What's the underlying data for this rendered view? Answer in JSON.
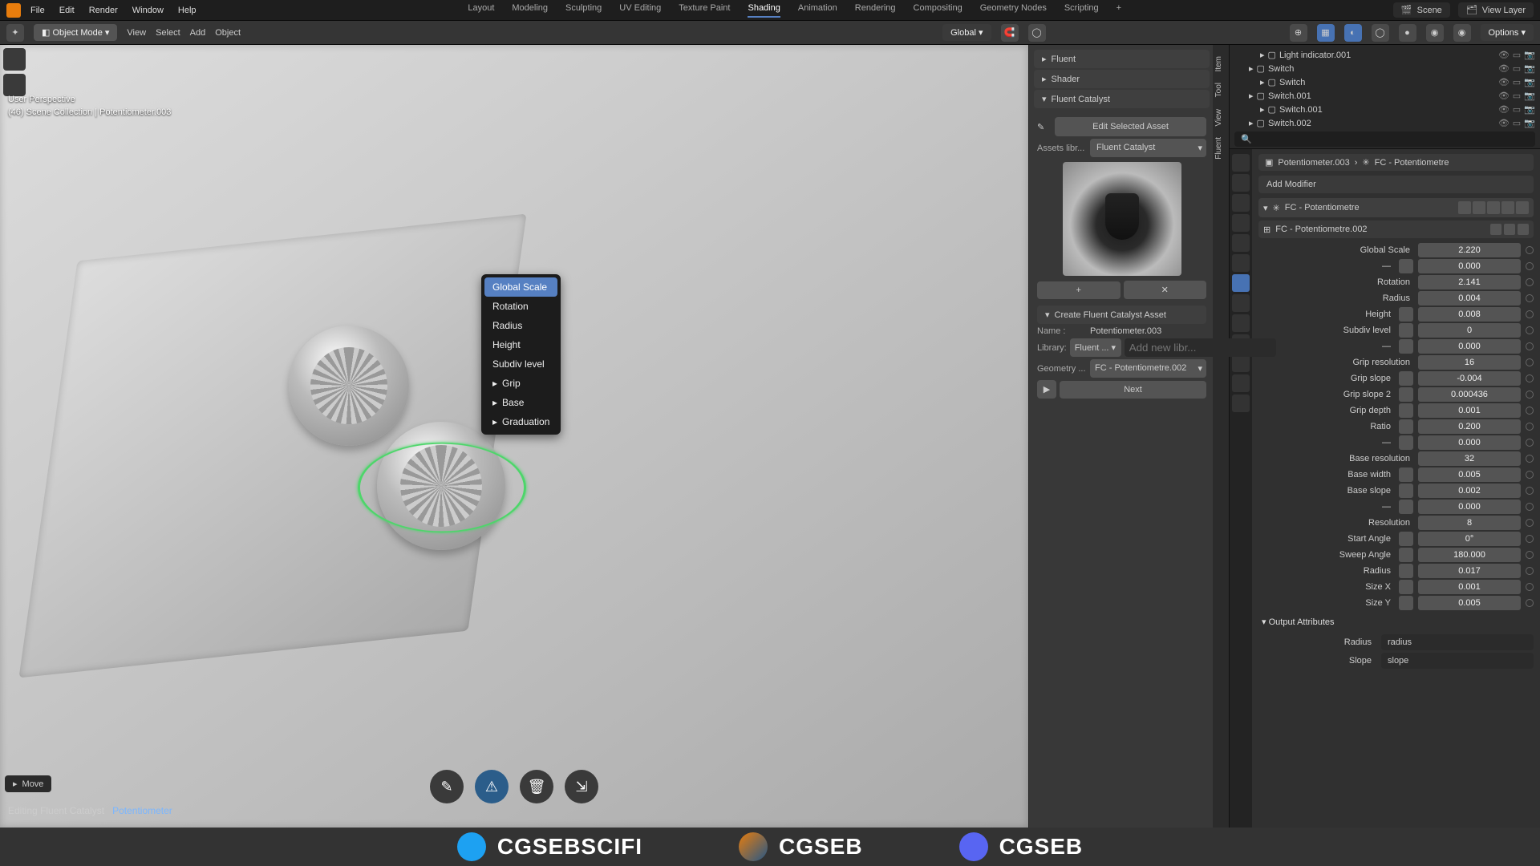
{
  "menubar": {
    "items": [
      "File",
      "Edit",
      "Render",
      "Window",
      "Help"
    ]
  },
  "workspaces": {
    "items": [
      "Layout",
      "Modeling",
      "Sculpting",
      "UV Editing",
      "Texture Paint",
      "Shading",
      "Animation",
      "Rendering",
      "Compositing",
      "Geometry Nodes",
      "Scripting"
    ],
    "active": "Shading"
  },
  "scene": {
    "label": "Scene",
    "layer": "View Layer"
  },
  "header2": {
    "mode": "Object Mode",
    "menus": [
      "View",
      "Select",
      "Add",
      "Object"
    ],
    "orientation": "Global",
    "options": "Options"
  },
  "viewport": {
    "hud1": "User Perspective",
    "hud2": "(46) Scene Collection | Potentiometer.003",
    "status_prefix": "Editing Fluent Catalyst",
    "status_obj": "Potentiometer",
    "move": "Move"
  },
  "ctxmenu": {
    "items": [
      {
        "label": "Global Scale",
        "sel": true
      },
      {
        "label": "Rotation"
      },
      {
        "label": "Radius"
      },
      {
        "label": "Height"
      },
      {
        "label": "Subdiv level"
      },
      {
        "label": "Grip",
        "sub": true
      },
      {
        "label": "Base",
        "sub": true
      },
      {
        "label": "Graduation",
        "sub": true
      }
    ]
  },
  "npanel": {
    "tabs": [
      "Item",
      "Tool",
      "View",
      "Fluent"
    ],
    "headers": [
      "Fluent",
      "Shader",
      "Fluent Catalyst"
    ],
    "edit_btn": "Edit Selected Asset",
    "assets_label": "Assets libr...",
    "assets_value": "Fluent Catalyst",
    "plus": "+",
    "x": "✕",
    "create_header": "Create Fluent Catalyst Asset",
    "name_label": "Name :",
    "name_value": "Potentiometer.003",
    "library_label": "Library:",
    "library_value": "Fluent ...",
    "library_placeholder": "Add new libr...",
    "geom_label": "Geometry ...",
    "geom_value": "FC - Potentiometre.002",
    "next": "Next",
    "play": "▶"
  },
  "outliner": {
    "rows": [
      {
        "indent": 2,
        "icon": "light",
        "name": "Light indicator.001"
      },
      {
        "indent": 1,
        "icon": "coll",
        "name": "Switch"
      },
      {
        "indent": 2,
        "icon": "mesh",
        "name": "Switch"
      },
      {
        "indent": 1,
        "icon": "coll",
        "name": "Switch.001"
      },
      {
        "indent": 2,
        "icon": "mesh",
        "name": "Switch.001"
      },
      {
        "indent": 1,
        "icon": "coll",
        "name": "Switch.002"
      }
    ]
  },
  "props": {
    "crumb1": "Potentiometer.003",
    "crumb2": "FC - Potentiometre",
    "add_modifier": "Add Modifier",
    "modifier_name": "FC - Potentiometre",
    "nodegroup": "FC - Potentiometre.002",
    "params": [
      {
        "label": "Global Scale",
        "value": "2.220"
      },
      {
        "label": "—",
        "value": "0.000",
        "icon": true
      },
      {
        "label": "Rotation",
        "value": "2.141"
      },
      {
        "label": "Radius",
        "value": "0.004"
      },
      {
        "label": "Height",
        "value": "0.008",
        "icon": true
      },
      {
        "label": "Subdiv level",
        "value": "0",
        "icon": true
      },
      {
        "label": "—",
        "value": "0.000",
        "icon": true
      },
      {
        "label": "Grip resolution",
        "value": "16"
      },
      {
        "label": "Grip slope",
        "value": "-0.004",
        "icon": true
      },
      {
        "label": "Grip slope 2",
        "value": "0.000436",
        "icon": true
      },
      {
        "label": "Grip depth",
        "value": "0.001",
        "icon": true
      },
      {
        "label": "Ratio",
        "value": "0.200",
        "icon": true
      },
      {
        "label": "—",
        "value": "0.000",
        "icon": true
      },
      {
        "label": "Base resolution",
        "value": "32"
      },
      {
        "label": "Base width",
        "value": "0.005",
        "icon": true
      },
      {
        "label": "Base slope",
        "value": "0.002",
        "icon": true
      },
      {
        "label": "—",
        "value": "0.000",
        "icon": true
      },
      {
        "label": "Resolution",
        "value": "8"
      },
      {
        "label": "Start Angle",
        "value": "0°",
        "icon": true
      },
      {
        "label": "Sweep Angle",
        "value": "180.000",
        "icon": true
      },
      {
        "label": "Radius",
        "value": "0.017",
        "icon": true
      },
      {
        "label": "Size X",
        "value": "0.001",
        "icon": true
      },
      {
        "label": "Size Y",
        "value": "0.005",
        "icon": true
      }
    ],
    "output_header": "Output Attributes",
    "outputs": [
      {
        "label": "Radius",
        "value": "radius"
      },
      {
        "label": "Slope",
        "value": "slope"
      }
    ]
  },
  "banner": {
    "items": [
      {
        "icon": "tw",
        "text": "CGSEBSCIFI"
      },
      {
        "icon": "bl",
        "text": "CGSEB"
      },
      {
        "icon": "dc",
        "text": "CGSEB"
      }
    ]
  }
}
